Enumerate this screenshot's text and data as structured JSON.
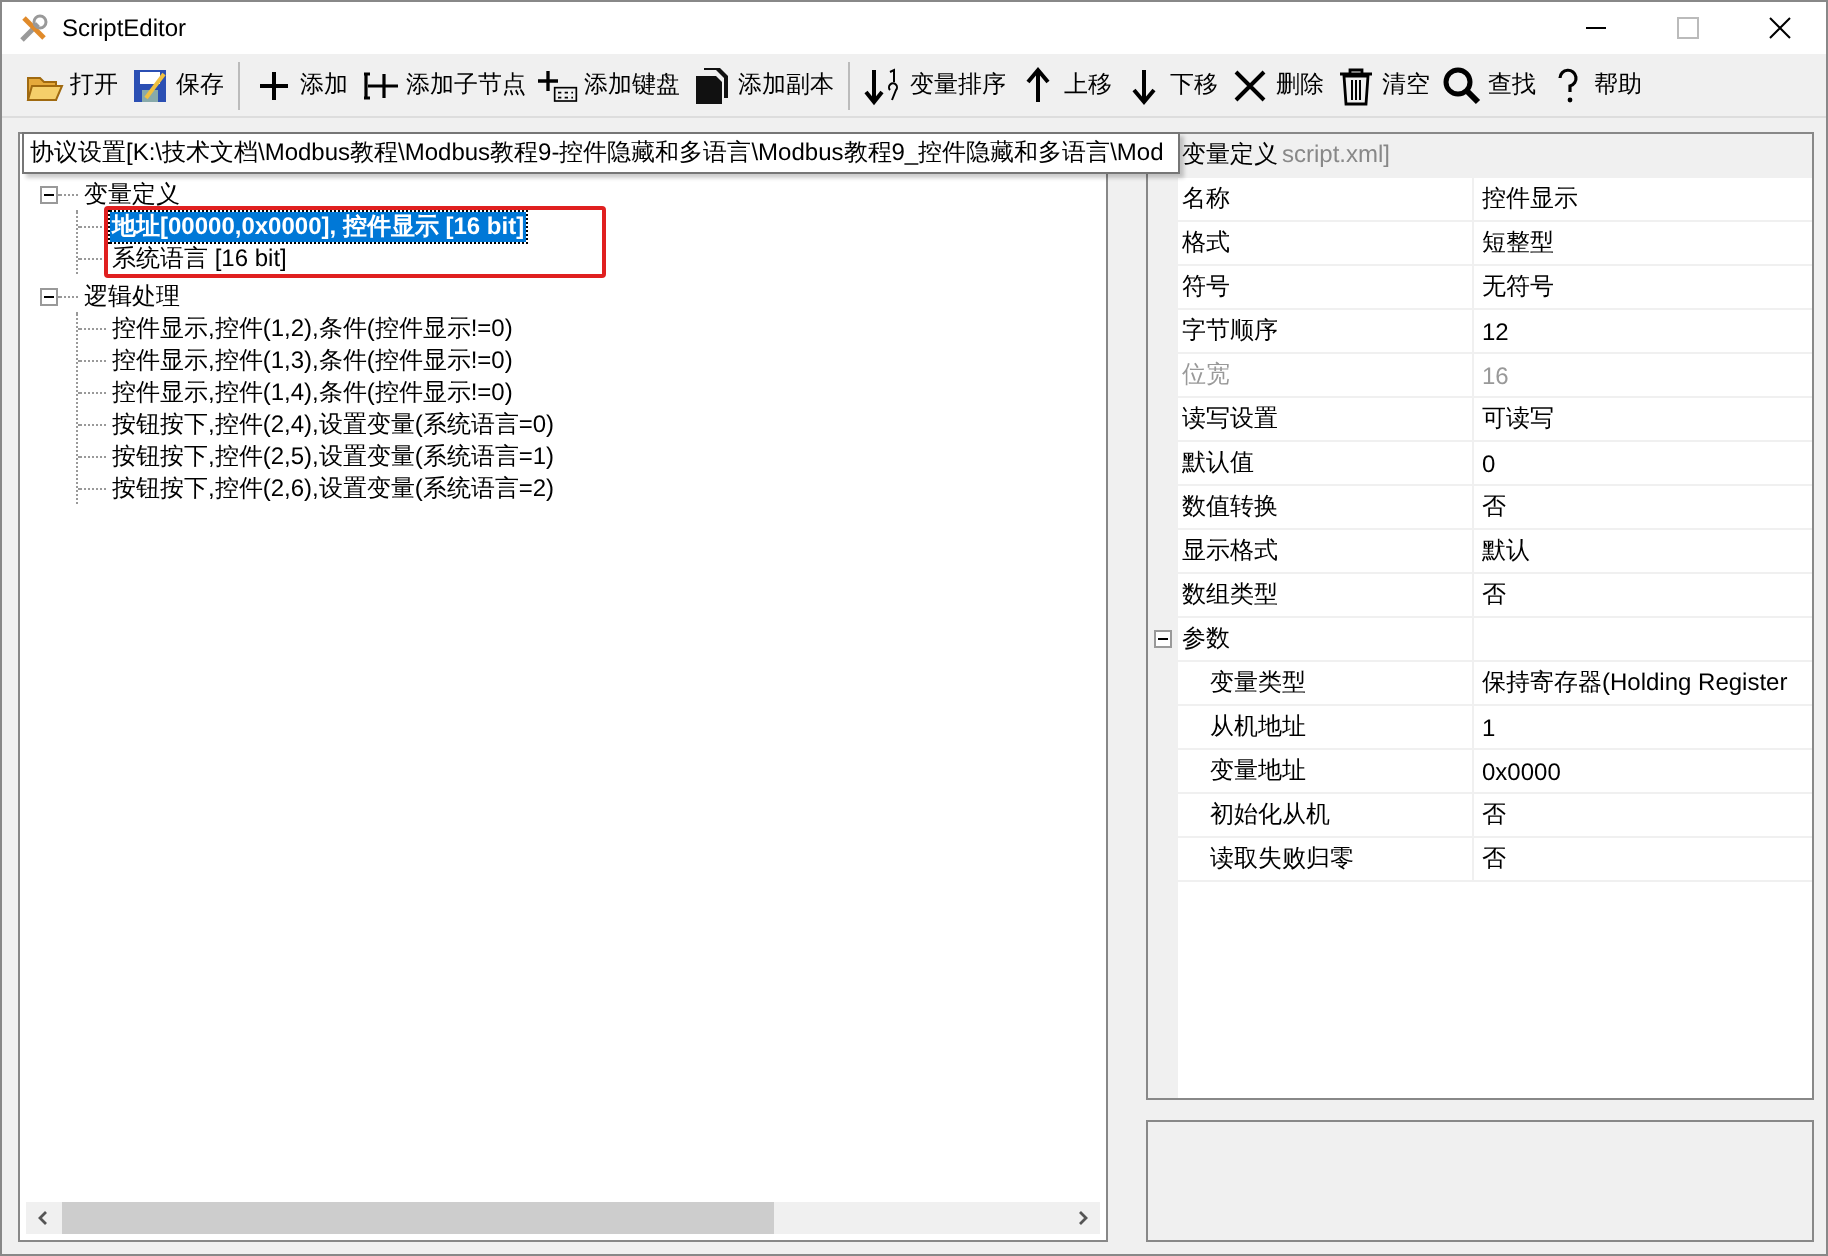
{
  "window": {
    "title": "ScriptEditor"
  },
  "toolbar_groups": [
    [
      {
        "label": "打开"
      },
      {
        "label": "保存"
      }
    ],
    [
      {
        "label": "添加"
      },
      {
        "label": "添加子节点"
      },
      {
        "label": "添加键盘"
      },
      {
        "label": "添加副本"
      }
    ],
    [
      {
        "label": "变量排序"
      },
      {
        "label": "上移"
      },
      {
        "label": "下移"
      },
      {
        "label": "删除"
      },
      {
        "label": "清空"
      },
      {
        "label": "查找"
      },
      {
        "label": "帮助"
      }
    ]
  ],
  "tooltip": {
    "text": "协议设置[K:\\技术文档\\Modbus教程\\Modbus教程9-控件隐藏和多语言\\Modbus教程9_控件隐藏和多语言\\Mod",
    "tail": "script.xml]"
  },
  "tree": [
    {
      "label": "变量定义",
      "expanded": true,
      "selected": false,
      "children": [
        {
          "label": "地址[00000,0x0000], 控件显示 [16 bit]",
          "selected": true
        },
        {
          "label": "系统语言 [16 bit]",
          "selected": false
        }
      ]
    },
    {
      "label": "逻辑处理",
      "expanded": true,
      "selected": false,
      "children": [
        {
          "label": "控件显示,控件(1,2),条件(控件显示!=0)",
          "selected": false
        },
        {
          "label": "控件显示,控件(1,3),条件(控件显示!=0)",
          "selected": false
        },
        {
          "label": "控件显示,控件(1,4),条件(控件显示!=0)",
          "selected": false
        },
        {
          "label": "按钮按下,控件(2,4),设置变量(系统语言=0)",
          "selected": false
        },
        {
          "label": "按钮按下,控件(2,5),设置变量(系统语言=1)",
          "selected": false
        },
        {
          "label": "按钮按下,控件(2,6),设置变量(系统语言=2)",
          "selected": false
        }
      ]
    }
  ],
  "property_grid": {
    "category": "变量定义",
    "rows": [
      {
        "kind": "property",
        "name": "名称",
        "value": "控件显示",
        "disabled": false
      },
      {
        "kind": "property",
        "name": "格式",
        "value": "短整型",
        "disabled": false
      },
      {
        "kind": "property",
        "name": "符号",
        "value": "无符号",
        "disabled": false
      },
      {
        "kind": "property",
        "name": "字节顺序",
        "value": "12",
        "disabled": false
      },
      {
        "kind": "property",
        "name": "位宽",
        "value": "16",
        "disabled": true
      },
      {
        "kind": "property",
        "name": "读写设置",
        "value": "可读写",
        "disabled": false
      },
      {
        "kind": "property",
        "name": "默认值",
        "value": "0",
        "disabled": false
      },
      {
        "kind": "property",
        "name": "数值转换",
        "value": "否",
        "disabled": false
      },
      {
        "kind": "property",
        "name": "显示格式",
        "value": "默认",
        "disabled": false
      },
      {
        "kind": "property",
        "name": "数组类型",
        "value": "否",
        "disabled": false
      },
      {
        "kind": "category",
        "name": "参数",
        "expanded": true,
        "children": [
          {
            "kind": "property",
            "name": "变量类型",
            "value": "保持寄存器(Holding Register",
            "disabled": false
          },
          {
            "kind": "property",
            "name": "从机地址",
            "value": "1",
            "disabled": false
          },
          {
            "kind": "property",
            "name": "变量地址",
            "value": "0x0000",
            "disabled": false
          },
          {
            "kind": "property",
            "name": "初始化从机",
            "value": "否",
            "disabled": false
          },
          {
            "kind": "property",
            "name": "读取失败归零",
            "value": "否",
            "disabled": false
          }
        ]
      }
    ]
  }
}
